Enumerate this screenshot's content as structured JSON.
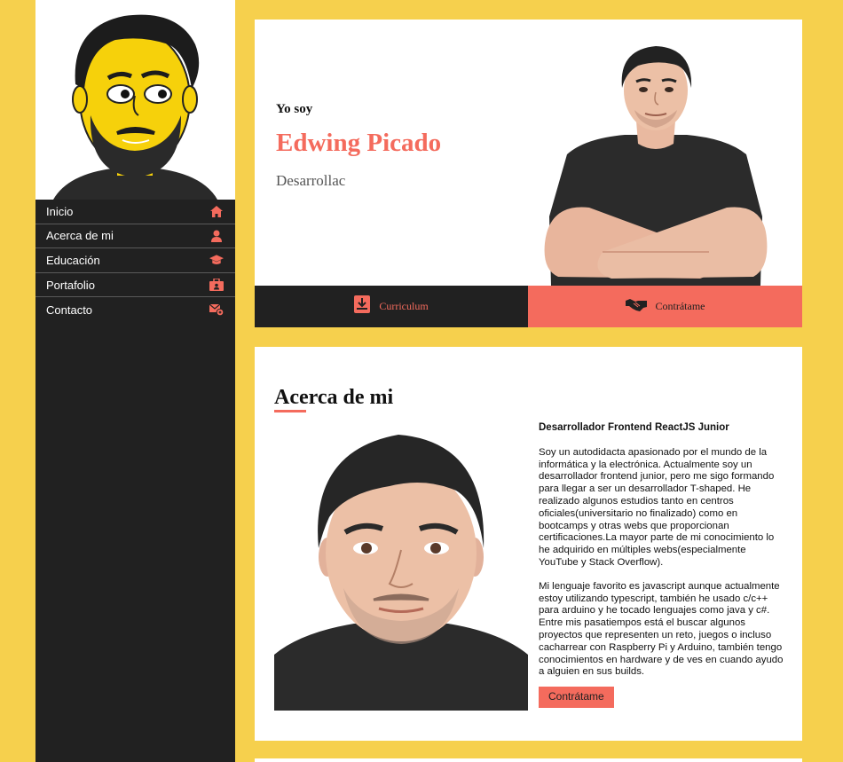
{
  "sidebar": {
    "items": [
      {
        "label": "Inicio",
        "icon": "home-icon"
      },
      {
        "label": "Acerca de mi",
        "icon": "user-icon"
      },
      {
        "label": "Educación",
        "icon": "graduation-cap-icon"
      },
      {
        "label": "Portafolio",
        "icon": "briefcase-icon"
      },
      {
        "label": "Contacto",
        "icon": "mail-icon"
      }
    ]
  },
  "hero": {
    "intro": "Yo soy",
    "name": "Edwing Picado",
    "role": "Desarrollac",
    "cv_button": "Curriculum",
    "hire_button": "Contrátame"
  },
  "about": {
    "title": "Acerca de mi",
    "subtitle": "Desarrollador Frontend ReactJS Junior",
    "paragraph1": "Soy un autodidacta apasionado por el mundo de la informática y la electrónica. Actualmente soy un desarrollador frontend junior, pero me sigo formando para llegar a ser un desarrollador T-shaped. He realizado algunos estudios tanto en centros oficiales(universitario no finalizado) como en bootcamps y otras webs que proporcionan certificaciones.La mayor parte de mi conocimiento lo he adquirido en múltiples webs(especialmente YouTube y Stack Overflow).",
    "paragraph2": "Mi lenguaje favorito es javascript aunque actualmente estoy utilizando typescript, también he usado c/c++ para arduino y he tocado lenguajes como java y c#. Entre mis pasatiempos está el buscar algunos proyectos que representen un reto, juegos o incluso cacharrear con Raspberry Pi y Arduino, también tengo conocimientos en hardware y de ves en cuando ayudo a alguien en sus builds.",
    "hire_button": "Contrátame"
  },
  "colors": {
    "accent": "#f46b5d",
    "background": "#f6d04d",
    "sidebar": "#212121"
  }
}
